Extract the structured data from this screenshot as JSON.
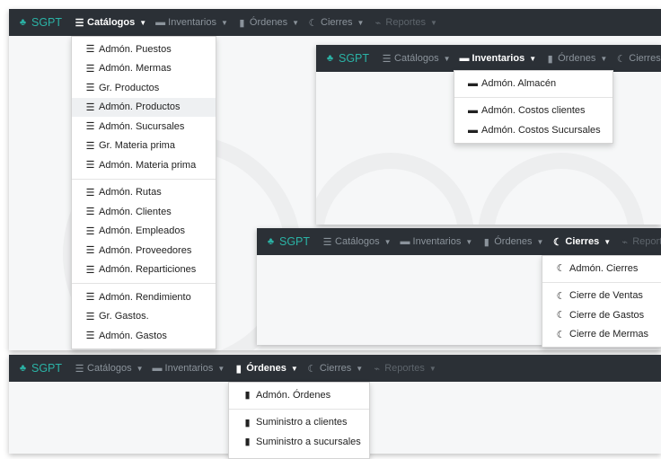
{
  "brand": "SGPT",
  "nav": {
    "catalogos": "Catálogos",
    "inventarios": "Inventarios",
    "ordenes": "Órdenes",
    "cierres": "Cierres",
    "reportes": "Reportes"
  },
  "catalogos_menu": {
    "group1": [
      "Admón. Puestos",
      "Admón. Mermas",
      "Gr. Productos",
      "Admón. Productos",
      "Admón. Sucursales",
      "Gr. Materia prima",
      "Admón. Materia prima"
    ],
    "group2": [
      "Admón. Rutas",
      "Admón. Clientes",
      "Admón. Empleados",
      "Admón. Proveedores",
      "Admón. Reparticiones"
    ],
    "group3": [
      "Admón. Rendimiento",
      "Gr. Gastos.",
      "Admón. Gastos"
    ]
  },
  "inventarios_menu": {
    "group1": [
      "Admón. Almacén"
    ],
    "group2": [
      "Admón. Costos clientes",
      "Admón. Costos Sucursales"
    ]
  },
  "cierres_menu": {
    "group1": [
      "Admón. Cierres"
    ],
    "group2": [
      "Cierre de Ventas",
      "Cierre de Gastos",
      "Cierre de Mermas"
    ]
  },
  "ordenes_menu": {
    "group1": [
      "Admón. Órdenes"
    ],
    "group2": [
      "Suministro a clientes",
      "Suministro a sucursales"
    ]
  },
  "colors": {
    "navbar": "#2b3036",
    "brand": "#2bb3a6",
    "active": "#ffffff",
    "inactive": "#8b939b"
  },
  "icons": {
    "brand": "sitemap-icon",
    "catalogos": "list-icon",
    "inventarios": "archive-icon",
    "ordenes": "clipboard-icon",
    "cierres": "moon-icon",
    "reportes": "chart-icon"
  }
}
